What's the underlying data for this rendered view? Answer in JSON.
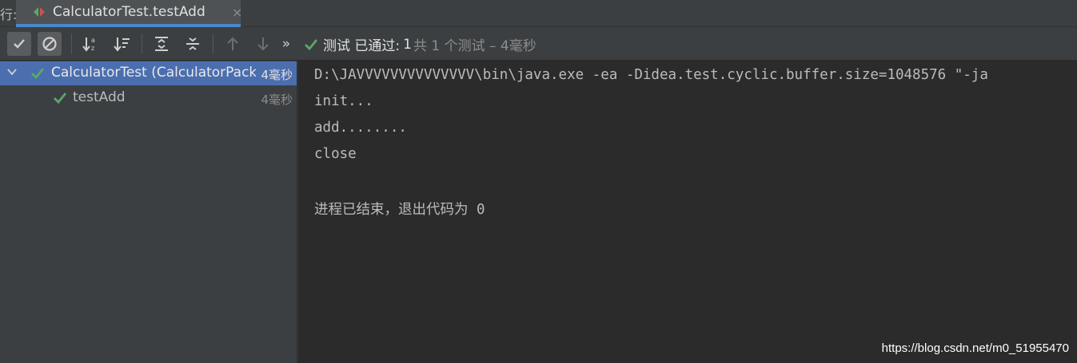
{
  "tabbar": {
    "prefix": "行:",
    "tab_label": "CalculatorTest.testAdd",
    "close_glyph": "×"
  },
  "toolbar": {
    "buttons": [
      {
        "name": "show-passed",
        "icon": "check-icon",
        "toggled": true
      },
      {
        "name": "show-ignored",
        "icon": "ignored-icon",
        "toggled": true
      },
      {
        "name": "sort-alphabetically",
        "icon": "sort-alpha-icon"
      },
      {
        "name": "sort-by-duration",
        "icon": "sort-duration-icon"
      },
      {
        "name": "expand-all",
        "icon": "expand-all-icon"
      },
      {
        "name": "collapse-all",
        "icon": "collapse-all-icon"
      },
      {
        "name": "previous-failed",
        "icon": "arrow-up-icon"
      },
      {
        "name": "next-failed",
        "icon": "arrow-down-icon"
      },
      {
        "name": "more",
        "icon": "chevron-double-right-icon"
      }
    ],
    "more_glyph": "»",
    "status_prefix": "测试 已通过:",
    "status_count": "1",
    "status_detail": "共 1 个测试 – 4毫秒"
  },
  "tree": {
    "items": [
      {
        "label": "CalculatorTest (CalculatorPackage)",
        "duration": "4毫秒",
        "expanded": true,
        "selected": true,
        "status": "passed"
      },
      {
        "label": "testAdd",
        "duration": "4毫秒",
        "selected": false,
        "status": "passed"
      }
    ]
  },
  "console": {
    "lines": [
      "D:\\JAVVVVVVVVVVVVVV\\bin\\java.exe -ea -Didea.test.cyclic.buffer.size=1048576 \"-ja",
      "init...",
      "add........",
      "close",
      "",
      "进程已结束，退出代码为 0"
    ]
  },
  "watermark": "https://blog.csdn.net/m0_51955470",
  "colors": {
    "accent": "#4a88c7",
    "passed": "#59a869",
    "selection": "#4b6eaf"
  }
}
